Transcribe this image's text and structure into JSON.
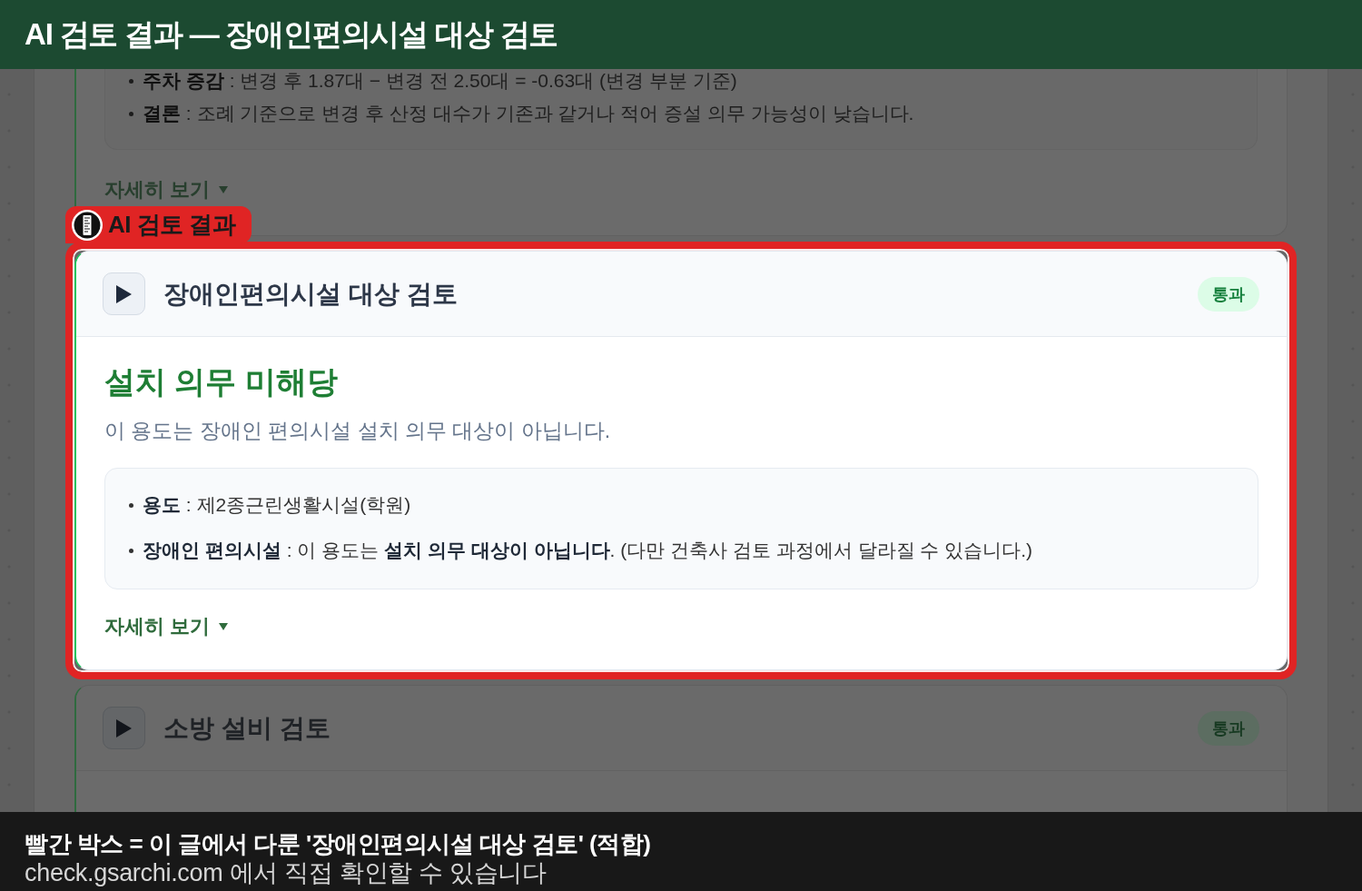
{
  "title_bar": {
    "text": "AI 검토 결과 — 장애인편의시설 대상 검토"
  },
  "cards": [
    {
      "highlighted": false,
      "bullets": [
        "**주차 증감** : 변경 후 1.87대 − 변경 전 2.50대 = -0.63대 (변경 부분 기준)",
        "**결론** : 조례 기준으로 변경 후 산정 대수가 기존과 같거나 적어 증설 의무 가능성이 낮습니다."
      ],
      "more_link": "자세히 보기"
    },
    {
      "highlighted": true,
      "highlight_label": "AI 검토 결과",
      "title": "장애인편의시설 대상 검토",
      "status": "통과",
      "heading": "설치 의무 미해당",
      "summary": "이 용도는 장애인 편의시설 설치 의무 대상이 아닙니다.",
      "bullets": [
        "**용도** : 제2종근린생활시설(학원)",
        "**장애인 편의시설** : 이 용도는 **설치 의무 대상이 아닙니다**. (다만 건축사 검토 과정에서 달라질 수 있습니다.)"
      ],
      "more_link": "자세히 보기"
    },
    {
      "highlighted": false,
      "title": "소방 설비 검토",
      "status": "통과"
    }
  ],
  "caption": {
    "title": "빨간 박스 = 이 글에서 다룬 '장애인편의시설 대상 검토' (적합)",
    "note": "check.gsarchi.com 에서 직접 확인할 수 있습니다"
  }
}
